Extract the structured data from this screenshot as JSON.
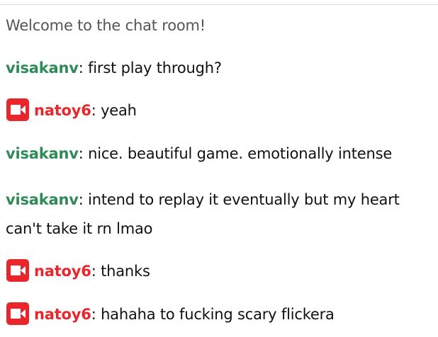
{
  "chat": {
    "welcome": "Welcome to the chat room!",
    "colors": {
      "visakanv": "#2e8b57",
      "natoy6": "#e8262c",
      "badge": "#e8262c",
      "welcome": "#555555"
    },
    "messages": [
      {
        "user": "visakanv",
        "badge": false,
        "sep": ": ",
        "text": "first play through?"
      },
      {
        "user": "natoy6",
        "badge": true,
        "badge_icon": "video-camera-icon",
        "sep": ": ",
        "text": "yeah"
      },
      {
        "user": "visakanv",
        "badge": false,
        "sep": ": ",
        "text": "nice. beautiful game. emotionally intense"
      },
      {
        "user": "visakanv",
        "badge": false,
        "sep": ": ",
        "text": "intend to replay it eventually but my heart can't take it rn lmao"
      },
      {
        "user": "natoy6",
        "badge": true,
        "badge_icon": "video-camera-icon",
        "sep": ": ",
        "text": "thanks"
      },
      {
        "user": "natoy6",
        "badge": true,
        "badge_icon": "video-camera-icon",
        "sep": ": ",
        "text": "hahaha to fucking scary flickera"
      }
    ]
  }
}
